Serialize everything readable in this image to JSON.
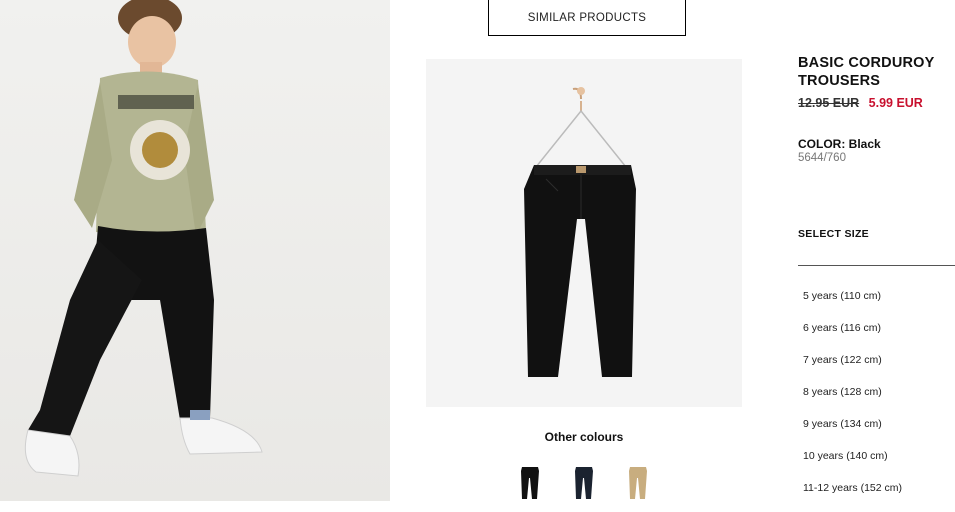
{
  "header": {
    "similar_products_label": "SIMILAR PRODUCTS"
  },
  "product": {
    "title": "BASIC CORDUROY TROUSERS",
    "old_price": "12.95 EUR",
    "new_price": "5.99 EUR",
    "color_label": "COLOR:",
    "color_value": "Black",
    "reference": "5644/760"
  },
  "sizes": {
    "heading": "SELECT SIZE",
    "options": [
      "5 years (110 cm)",
      "6 years (116 cm)",
      "7 years (122 cm)",
      "8 years (128 cm)",
      "9 years (134 cm)",
      "10 years (140 cm)",
      "11-12 years (152 cm)"
    ]
  },
  "other_colours": {
    "heading": "Other colours",
    "swatches": [
      {
        "name": "black",
        "color": "#111111"
      },
      {
        "name": "navy",
        "color": "#1b2330"
      },
      {
        "name": "beige",
        "color": "#c8ad7f"
      }
    ]
  },
  "colors": {
    "sale_red": "#c8102e",
    "border": "#000000",
    "product_bg": "#f4f4f4"
  }
}
